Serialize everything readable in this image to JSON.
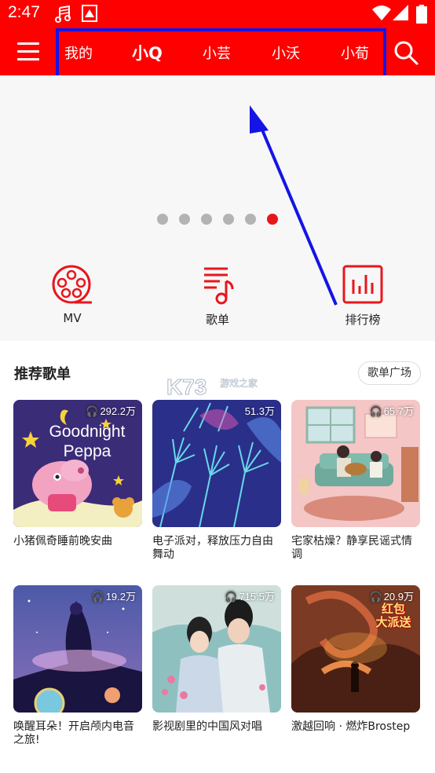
{
  "status": {
    "time": "2:47",
    "icons": [
      "music-note-icon",
      "image-icon",
      "wifi-icon",
      "signal-icon",
      "battery-icon"
    ]
  },
  "nav": {
    "tabs": [
      {
        "label": "我的"
      },
      {
        "label": "小Q"
      },
      {
        "label": "小芸"
      },
      {
        "label": "小沃"
      },
      {
        "label": "小荀"
      }
    ],
    "active_tab": "小Q",
    "icons": [
      "menu-icon",
      "search-icon"
    ]
  },
  "carousel": {
    "count": 6,
    "active_index": 5
  },
  "quick_entries": [
    {
      "label": "MV",
      "icon": "film-reel-icon"
    },
    {
      "label": "歌单",
      "icon": "playlist-icon"
    },
    {
      "label": "排行榜",
      "icon": "chart-icon"
    }
  ],
  "section": {
    "title": "推荐歌单",
    "plaza_label": "歌单广场"
  },
  "watermark": {
    "text_main": "K73",
    "text_sub": "游戏之家"
  },
  "playlists": [
    {
      "title": "小猪佩奇睡前晚安曲",
      "count": "292.2万",
      "cover_text": "Goodnight Peppa"
    },
    {
      "title": "电子派对，释放压力自由舞动",
      "count": "51.3万"
    },
    {
      "title": "宅家枯燥？静享民谣式情调",
      "count": "65.7万"
    },
    {
      "title": "唤醒耳朵！开启颅内电音之旅!",
      "count": "19.2万"
    },
    {
      "title": "影视剧里的中国风对唱",
      "count": "715.5万"
    },
    {
      "title": "激越回响 · 燃炸Brostep",
      "count": "20.9万",
      "cover_text_1": "红包",
      "cover_text_2": "大派送"
    }
  ],
  "colors": {
    "brand": "#ff0000",
    "accent": "#e8161c",
    "annotation": "#1414e6"
  }
}
